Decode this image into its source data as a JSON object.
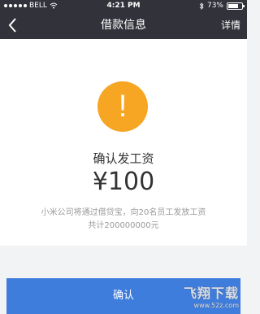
{
  "status_bar": {
    "carrier": "BELL",
    "time": "4:21 PM",
    "battery": "73%",
    "battery_level": 0.73
  },
  "nav": {
    "title": "借款信息",
    "detail_label": "详情"
  },
  "content": {
    "title": "确认发工资",
    "amount": "¥100",
    "desc_line1": "小米公司将通过借贷宝，向20名员工发放工资",
    "desc_line2": "共计200000000元"
  },
  "button": {
    "label": "确认"
  },
  "watermark": {
    "main": "飞翔下载",
    "sub": "www.52z.com"
  },
  "colors": {
    "nav_bg": "#31323a",
    "warning": "#f6a623",
    "primary_button": "#3f7ddc"
  },
  "icons": {
    "back": "chevron-left-icon",
    "warning": "exclamation-icon",
    "wifi": "wifi-icon",
    "bluetooth": "bluetooth-icon",
    "battery": "battery-icon"
  }
}
